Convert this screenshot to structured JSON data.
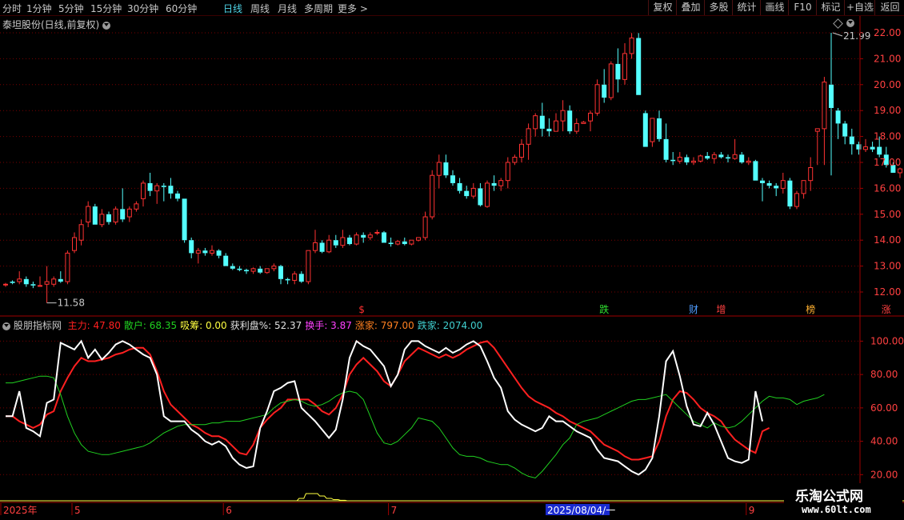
{
  "toolbar": {
    "periods": [
      "分时",
      "1分钟",
      "5分钟",
      "15分钟",
      "30分钟",
      "60分钟",
      "日线",
      "周线",
      "月线",
      "多周期",
      "更多 >"
    ],
    "active_period": "日线",
    "right_buttons": [
      "复权",
      "叠加",
      "多股",
      "统计",
      "画线",
      "F10",
      "标记",
      "+自选",
      "返回"
    ]
  },
  "main_chart": {
    "title": "泰坦股份(日线,前复权)",
    "price_labels": [
      "22.00",
      "21.00",
      "20.00",
      "19.00",
      "18.00",
      "17.00",
      "16.00",
      "15.00",
      "14.00",
      "13.00",
      "12.00"
    ],
    "high_marker": "21.99",
    "low_marker": "11.58",
    "event_markers": [
      {
        "label": "$",
        "color": "#ff3030",
        "index": 52
      },
      {
        "label": "跌",
        "color": "#30e030",
        "index": 87
      },
      {
        "label": "财",
        "color": "#4f9cff",
        "index": 100
      },
      {
        "label": "增",
        "color": "#ff4040",
        "index": 104
      },
      {
        "label": "榜",
        "color": "#ffb030",
        "index": 117
      },
      {
        "label": "涨",
        "color": "#ff4040",
        "index": 128
      }
    ],
    "colors": {
      "up": "#ff3232",
      "down": "#54ffff",
      "grid": "#7a0000",
      "axis": "#a00000"
    }
  },
  "indicator": {
    "name": "股朋指标网",
    "legend": [
      {
        "label": "主力: 47.80",
        "color": "#ff2020"
      },
      {
        "label": "散户: 68.35",
        "color": "#20d020"
      },
      {
        "label": "吸筹: 0.00",
        "color": "#ffff40"
      },
      {
        "label": "获利盘%: 52.37",
        "color": "#e0e0e0"
      },
      {
        "label": "换手: 3.87",
        "color": "#ff40ff"
      },
      {
        "label": "涨家: 797.00",
        "color": "#ff8020"
      },
      {
        "label": "跌家: 2074.00",
        "color": "#40d0d0"
      }
    ],
    "axis_labels": [
      "100.00",
      "80.00",
      "60.00",
      "40.00",
      "20.00"
    ]
  },
  "date_axis": {
    "labels": [
      {
        "text": "2025年",
        "index": 0
      },
      {
        "text": "5",
        "index": 10
      },
      {
        "text": "6",
        "index": 32
      },
      {
        "text": "7",
        "index": 56
      },
      {
        "text": "8",
        "index": 83
      },
      {
        "text": "9",
        "index": 108
      }
    ],
    "cursor_date": "2025/08/04/一"
  },
  "watermark": {
    "line1": "乐淘公式网",
    "line2": "www.60lt.com"
  },
  "chart_data": {
    "type": "candlestick",
    "title": "泰坦股份(日线,前复权)",
    "ylim": [
      11.6,
      22.5
    ],
    "candles": [
      [
        12.3,
        12.35,
        12.2,
        12.3
      ],
      [
        12.4,
        12.45,
        12.3,
        12.35
      ],
      [
        12.4,
        12.8,
        12.3,
        12.5
      ],
      [
        12.5,
        12.6,
        12.2,
        12.3
      ],
      [
        12.3,
        12.4,
        12.15,
        12.25
      ],
      [
        12.25,
        12.6,
        12.2,
        12.25
      ],
      [
        12.3,
        13.0,
        11.58,
        12.4
      ],
      [
        12.3,
        12.6,
        12.2,
        12.5
      ],
      [
        12.5,
        12.8,
        12.35,
        12.4
      ],
      [
        12.4,
        13.6,
        12.3,
        13.5
      ],
      [
        13.6,
        14.3,
        13.5,
        14.1
      ],
      [
        14.0,
        14.8,
        13.8,
        14.6
      ],
      [
        14.7,
        15.5,
        14.5,
        15.3
      ],
      [
        15.3,
        15.4,
        14.6,
        14.6
      ],
      [
        14.6,
        15.2,
        14.5,
        15.0
      ],
      [
        15.0,
        15.1,
        14.6,
        14.7
      ],
      [
        14.7,
        15.3,
        14.6,
        15.2
      ],
      [
        15.2,
        16.0,
        14.7,
        14.8
      ],
      [
        14.9,
        15.3,
        14.7,
        15.2
      ],
      [
        15.2,
        15.5,
        15.1,
        15.4
      ],
      [
        15.6,
        16.3,
        15.3,
        16.2
      ],
      [
        16.2,
        16.6,
        15.7,
        15.9
      ],
      [
        15.9,
        16.2,
        15.4,
        16.1
      ],
      [
        16.1,
        16.2,
        15.5,
        16.05
      ],
      [
        16.1,
        16.4,
        15.6,
        15.8
      ],
      [
        15.8,
        15.9,
        15.5,
        15.6
      ],
      [
        15.6,
        15.6,
        13.9,
        14.0
      ],
      [
        14.0,
        14.1,
        13.3,
        13.5
      ],
      [
        13.5,
        13.7,
        13.1,
        13.6
      ],
      [
        13.6,
        13.7,
        13.4,
        13.5
      ],
      [
        13.5,
        13.8,
        13.4,
        13.6
      ],
      [
        13.6,
        13.65,
        13.3,
        13.4
      ],
      [
        13.4,
        13.5,
        13.0,
        13.0
      ],
      [
        13.0,
        13.1,
        12.85,
        12.9
      ],
      [
        12.9,
        13.0,
        12.8,
        12.85
      ],
      [
        12.85,
        12.9,
        12.7,
        12.8
      ],
      [
        12.8,
        12.95,
        12.7,
        12.9
      ],
      [
        12.9,
        13.0,
        12.7,
        12.75
      ],
      [
        12.75,
        12.9,
        12.7,
        12.9
      ],
      [
        12.9,
        13.1,
        12.8,
        13.0
      ],
      [
        13.0,
        13.05,
        12.3,
        12.5
      ],
      [
        12.5,
        12.55,
        12.3,
        12.45
      ],
      [
        12.45,
        12.8,
        12.3,
        12.7
      ],
      [
        12.7,
        12.8,
        12.35,
        12.4
      ],
      [
        12.4,
        13.6,
        12.3,
        13.6
      ],
      [
        13.6,
        14.4,
        13.5,
        13.9
      ],
      [
        13.9,
        14.0,
        13.5,
        13.55
      ],
      [
        13.55,
        14.2,
        13.5,
        14.0
      ],
      [
        14.0,
        14.2,
        13.7,
        13.8
      ],
      [
        13.8,
        14.4,
        13.7,
        14.1
      ],
      [
        14.1,
        14.2,
        13.8,
        13.85
      ],
      [
        13.85,
        14.3,
        13.8,
        14.2
      ],
      [
        14.2,
        14.3,
        13.9,
        14.1
      ],
      [
        14.1,
        14.3,
        14.0,
        14.2
      ],
      [
        14.3,
        14.4,
        14.2,
        14.3
      ],
      [
        14.3,
        14.35,
        13.9,
        13.9
      ],
      [
        13.9,
        14.1,
        13.75,
        13.85
      ],
      [
        13.85,
        14.0,
        13.8,
        13.95
      ],
      [
        13.95,
        14.1,
        13.8,
        13.85
      ],
      [
        13.85,
        14.0,
        13.8,
        14.0
      ],
      [
        14.0,
        14.1,
        13.95,
        14.1
      ],
      [
        14.1,
        15.1,
        14.0,
        14.9
      ],
      [
        14.9,
        16.7,
        14.8,
        16.5
      ],
      [
        16.5,
        17.3,
        16.0,
        17.0
      ],
      [
        17.0,
        17.3,
        16.4,
        16.5
      ],
      [
        16.5,
        16.7,
        16.1,
        16.2
      ],
      [
        16.2,
        16.4,
        15.8,
        15.9
      ],
      [
        15.9,
        16.1,
        15.6,
        15.7
      ],
      [
        15.7,
        16.2,
        15.6,
        16.0
      ],
      [
        16.0,
        16.2,
        15.3,
        15.35
      ],
      [
        15.3,
        16.3,
        15.25,
        16.2
      ],
      [
        16.2,
        16.5,
        15.9,
        16.1
      ],
      [
        16.1,
        16.4,
        15.9,
        16.3
      ],
      [
        16.3,
        17.2,
        16.0,
        17.0
      ],
      [
        17.0,
        17.3,
        16.9,
        17.2
      ],
      [
        17.2,
        17.9,
        17.0,
        17.7
      ],
      [
        17.7,
        18.5,
        17.1,
        18.3
      ],
      [
        18.3,
        18.9,
        18.0,
        18.8
      ],
      [
        18.8,
        19.3,
        18.0,
        18.3
      ],
      [
        18.3,
        18.7,
        18.0,
        18.2
      ],
      [
        18.2,
        18.9,
        18.2,
        18.6
      ],
      [
        18.6,
        19.4,
        18.2,
        19.0
      ],
      [
        19.0,
        19.2,
        18.1,
        18.2
      ],
      [
        18.2,
        18.7,
        18.1,
        18.5
      ],
      [
        18.5,
        18.6,
        18.5,
        18.55
      ],
      [
        18.6,
        19.0,
        18.2,
        18.9
      ],
      [
        18.9,
        20.2,
        18.8,
        20.0
      ],
      [
        20.0,
        20.6,
        19.3,
        19.5
      ],
      [
        19.5,
        20.9,
        19.4,
        20.8
      ],
      [
        20.8,
        21.4,
        19.7,
        20.2
      ],
      [
        20.2,
        21.6,
        20.0,
        21.2
      ],
      [
        21.2,
        21.99,
        21.0,
        21.8
      ],
      [
        21.8,
        21.99,
        19.6,
        19.6
      ],
      [
        18.9,
        19.0,
        17.6,
        17.6
      ],
      [
        17.8,
        18.7,
        17.6,
        18.7
      ],
      [
        18.7,
        19.0,
        17.8,
        17.9
      ],
      [
        17.9,
        18.5,
        17.0,
        17.1
      ],
      [
        17.1,
        17.4,
        16.9,
        17.05
      ],
      [
        17.05,
        17.4,
        16.95,
        17.2
      ],
      [
        17.2,
        17.3,
        16.9,
        17.0
      ],
      [
        17.0,
        17.2,
        16.9,
        17.05
      ],
      [
        17.05,
        17.3,
        17.0,
        17.25
      ],
      [
        17.25,
        17.4,
        17.1,
        17.15
      ],
      [
        17.15,
        17.4,
        16.95,
        17.3
      ],
      [
        17.3,
        17.4,
        17.15,
        17.2
      ],
      [
        17.2,
        17.3,
        17.0,
        17.15
      ],
      [
        17.15,
        17.9,
        17.1,
        17.3
      ],
      [
        17.3,
        17.4,
        16.95,
        17.0
      ],
      [
        17.0,
        17.2,
        16.9,
        17.05
      ],
      [
        17.05,
        17.1,
        16.3,
        16.3
      ],
      [
        16.3,
        16.4,
        15.5,
        16.2
      ],
      [
        16.2,
        16.3,
        16.0,
        16.1
      ],
      [
        16.1,
        16.2,
        15.7,
        16.0
      ],
      [
        16.0,
        16.6,
        15.8,
        16.3
      ],
      [
        16.3,
        16.4,
        15.2,
        15.3
      ],
      [
        15.3,
        15.9,
        15.2,
        15.8
      ],
      [
        15.8,
        16.3,
        15.6,
        16.3
      ],
      [
        16.3,
        17.2,
        15.9,
        16.8
      ],
      [
        18.2,
        18.3,
        16.9,
        18.3
      ],
      [
        18.3,
        20.3,
        16.9,
        20.1
      ],
      [
        20.0,
        22.0,
        16.5,
        19.1
      ],
      [
        19.0,
        19.1,
        17.9,
        18.5
      ],
      [
        18.5,
        18.6,
        17.7,
        18.0
      ],
      [
        18.0,
        18.3,
        17.3,
        17.7
      ],
      [
        17.7,
        17.8,
        17.3,
        17.5
      ],
      [
        17.5,
        17.9,
        17.4,
        17.6
      ],
      [
        17.6,
        17.8,
        17.4,
        17.5
      ],
      [
        17.6,
        18.0,
        17.2,
        17.3
      ],
      [
        17.3,
        17.6,
        16.8,
        16.9
      ],
      [
        16.9,
        17.0,
        16.6,
        16.6
      ],
      [
        16.6,
        16.8,
        16.4,
        16.75
      ],
      [
        16.8,
        16.9,
        16.1,
        16.6
      ],
      [
        16.6,
        18.2,
        16.5,
        18.2
      ],
      [
        18.2,
        18.25,
        17.6,
        17.7
      ]
    ],
    "indicator_series": [
      {
        "name": "主力",
        "color": "#ff2020",
        "values": [
          55,
          55,
          52,
          50,
          48,
          50,
          56,
          58,
          70,
          78,
          85,
          90,
          88,
          88,
          89,
          90,
          92,
          93,
          95,
          96,
          96,
          92,
          82,
          70,
          62,
          58,
          54,
          50,
          48,
          45,
          43,
          43,
          41,
          37,
          33,
          32,
          38,
          48,
          53,
          57,
          60,
          65,
          65,
          65,
          65,
          62,
          58,
          56,
          60,
          68,
          80,
          86,
          90,
          86,
          82,
          76,
          73,
          80,
          88,
          92,
          96,
          94,
          92,
          90,
          92,
          90,
          92,
          95,
          97,
          99,
          100,
          96,
          90,
          84,
          78,
          72,
          67,
          64,
          62,
          60,
          57,
          55,
          52,
          50,
          48,
          46,
          42,
          38,
          36,
          34,
          31,
          29,
          29,
          30,
          31,
          40,
          55,
          65,
          70,
          69,
          65,
          60,
          57,
          55,
          52,
          46,
          41,
          38,
          35,
          33,
          46,
          48
        ]
      },
      {
        "name": "散户",
        "color": "#20d020",
        "values": [
          75,
          75,
          76,
          77,
          78,
          79,
          79,
          78,
          68,
          55,
          45,
          38,
          34,
          33,
          32,
          32,
          33,
          34,
          35,
          36,
          37,
          39,
          42,
          45,
          47,
          49,
          50,
          50,
          50,
          50,
          51,
          51,
          52,
          52,
          52,
          53,
          54,
          55,
          56,
          60,
          63,
          64,
          65,
          64,
          62,
          61,
          62,
          64,
          67,
          69,
          70,
          69,
          65,
          55,
          45,
          39,
          38,
          40,
          44,
          48,
          54,
          53,
          52,
          48,
          42,
          36,
          32,
          31,
          31,
          30,
          28,
          27,
          26,
          26,
          24,
          21,
          19,
          18,
          22,
          27,
          32,
          38,
          42,
          50,
          52,
          53,
          54,
          56,
          58,
          60,
          62,
          64,
          65,
          65,
          66,
          67,
          68,
          64,
          60,
          56,
          52,
          50,
          48,
          51,
          49,
          48,
          49,
          52,
          56,
          60,
          64,
          67,
          66,
          66,
          65,
          62,
          64,
          65,
          66,
          68
        ]
      },
      {
        "name": "获利盘%",
        "color": "#ffffff",
        "values": [
          55,
          55,
          70,
          48,
          46,
          43,
          63,
          65,
          99,
          97,
          95,
          100,
          90,
          95,
          89,
          93,
          98,
          100,
          98,
          95,
          92,
          90,
          80,
          55,
          52,
          52,
          52,
          47,
          44,
          40,
          38,
          40,
          37,
          30,
          26,
          24,
          25,
          48,
          58,
          70,
          72,
          75,
          76,
          60,
          56,
          52,
          47,
          42,
          47,
          65,
          90,
          100,
          97,
          95,
          90,
          85,
          73,
          80,
          95,
          100,
          100,
          97,
          95,
          93,
          96,
          93,
          95,
          98,
          100,
          97,
          88,
          78,
          72,
          58,
          53,
          50,
          48,
          46,
          48,
          55,
          52,
          52,
          49,
          46,
          44,
          42,
          35,
          30,
          29,
          28,
          25,
          22,
          20,
          23,
          30,
          55,
          88,
          94,
          79,
          61,
          50,
          49,
          57,
          50,
          40,
          30,
          28,
          27,
          29,
          70,
          52
        ]
      },
      {
        "name": "吸筹",
        "color": "#ffff40",
        "values": [
          0,
          0,
          0,
          0,
          0,
          0,
          0,
          0,
          0,
          0,
          0,
          0,
          0,
          0,
          0,
          0,
          0,
          0,
          0,
          0,
          0,
          0,
          0,
          0,
          0,
          0,
          0,
          0,
          0,
          0,
          0,
          0,
          0,
          0,
          0,
          0,
          0,
          0,
          0,
          0,
          0,
          0,
          0,
          1,
          3,
          3,
          2,
          1,
          0.5,
          0.2,
          0,
          0,
          0,
          0,
          0,
          0,
          0,
          0,
          0,
          0,
          0,
          0,
          0,
          0,
          0,
          0,
          0,
          0,
          0,
          0,
          0,
          0,
          0,
          0,
          0,
          0,
          0,
          0,
          0,
          0,
          0,
          0,
          0,
          0,
          0,
          0,
          0,
          0,
          0,
          0,
          0,
          0,
          0,
          0,
          0,
          0,
          0,
          0,
          0,
          0,
          0,
          0,
          0,
          0,
          0,
          0,
          0,
          0,
          0,
          0,
          0,
          0,
          0,
          0,
          4,
          4,
          2,
          1,
          0.5,
          3,
          4,
          2,
          1,
          0.5,
          0.3,
          0.2,
          0.1,
          0,
          0,
          0,
          0,
          0,
          0
        ]
      }
    ],
    "indicator_ylim": [
      12,
      105
    ]
  }
}
